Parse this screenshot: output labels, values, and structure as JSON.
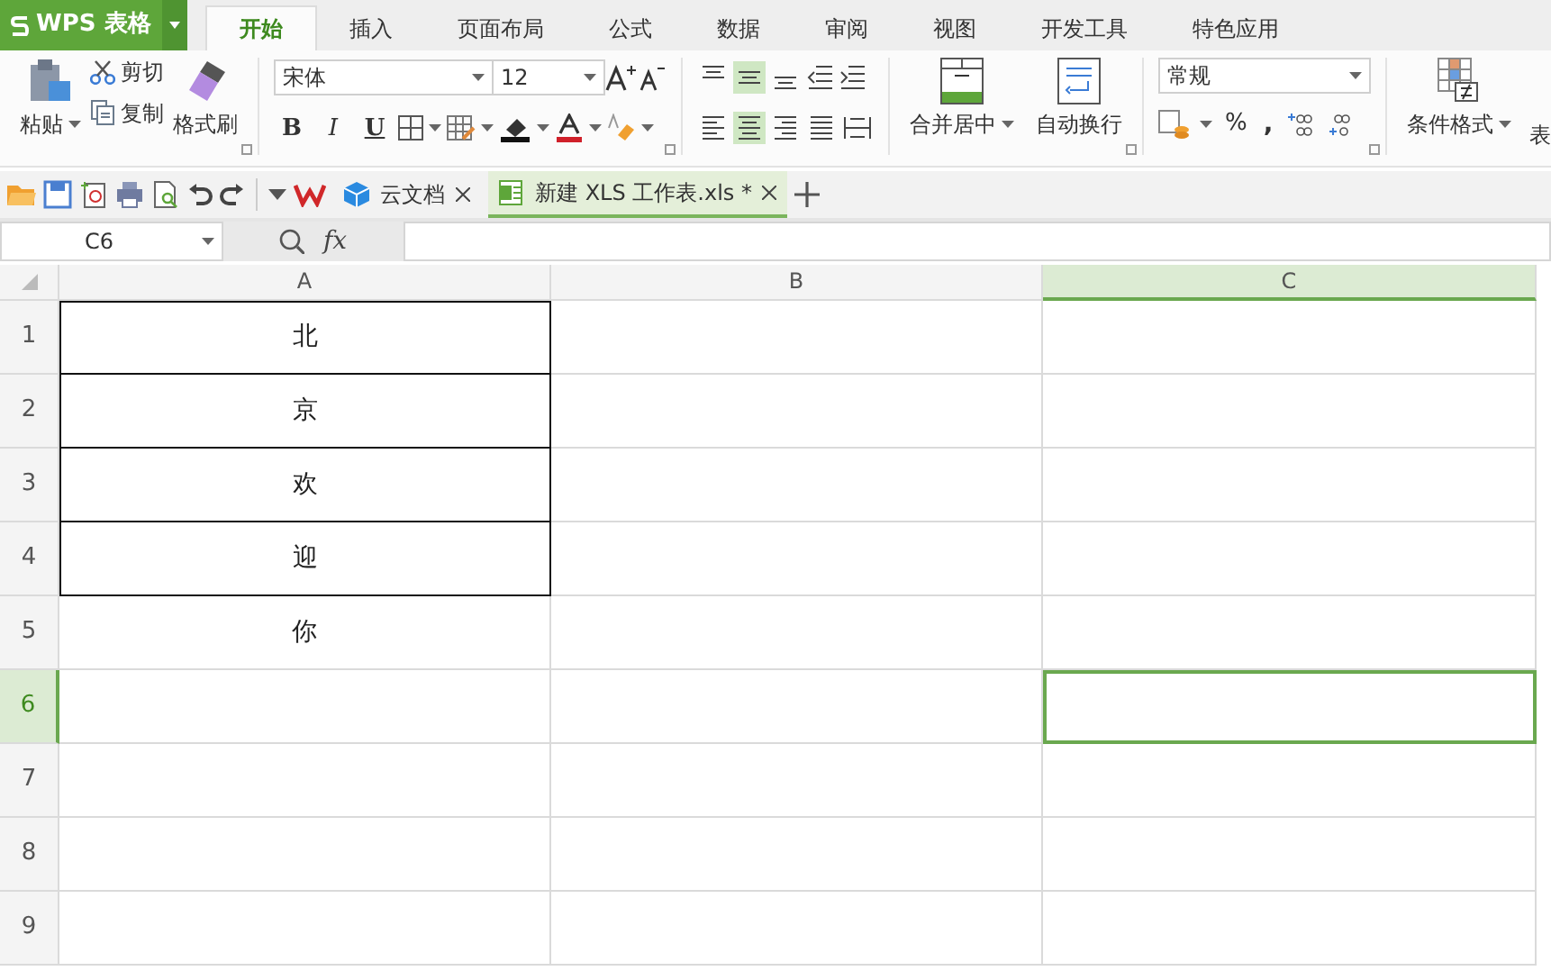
{
  "app": {
    "logo": "WPS 表格"
  },
  "menu_tabs": [
    {
      "label": "开始",
      "selected": true
    },
    {
      "label": "插入",
      "selected": false
    },
    {
      "label": "页面布局",
      "selected": false
    },
    {
      "label": "公式",
      "selected": false
    },
    {
      "label": "数据",
      "selected": false
    },
    {
      "label": "审阅",
      "selected": false
    },
    {
      "label": "视图",
      "selected": false
    },
    {
      "label": "开发工具",
      "selected": false
    },
    {
      "label": "特色应用",
      "selected": false
    }
  ],
  "ribbon": {
    "paste": "粘贴",
    "cut": "剪切",
    "copy": "复制",
    "format_painter": "格式刷",
    "font_name": "宋体",
    "font_size": "12",
    "bold": "B",
    "italic": "I",
    "underline": "U",
    "vertical_align": [
      {
        "kind": "top",
        "selected": false
      },
      {
        "kind": "middle",
        "selected": true
      },
      {
        "kind": "bottom",
        "selected": false
      }
    ],
    "horizontal_align": [
      {
        "kind": "left",
        "selected": false
      },
      {
        "kind": "center",
        "selected": true
      },
      {
        "kind": "right",
        "selected": false
      },
      {
        "kind": "justify",
        "selected": false
      },
      {
        "kind": "distributed",
        "selected": false
      }
    ],
    "merge": "合并居中",
    "wrap": "自动换行",
    "number_format": "常规",
    "percent": "%",
    "comma": ",",
    "conditional": "条件格式",
    "table_style": "表"
  },
  "doc_tabs": [
    {
      "label": "云文档",
      "selected": false
    },
    {
      "label": "新建 XLS 工作表.xls *",
      "selected": true
    }
  ],
  "formula_bar": {
    "name_box": "C6",
    "fx": "fx"
  },
  "columns": [
    {
      "label": "A",
      "selected": false
    },
    {
      "label": "B",
      "selected": false
    },
    {
      "label": "C",
      "selected": true
    }
  ],
  "rows": [
    {
      "label": "1",
      "selected": false,
      "a": {
        "text": "北",
        "bordered": true
      }
    },
    {
      "label": "2",
      "selected": false,
      "a": {
        "text": "京",
        "bordered": true
      }
    },
    {
      "label": "3",
      "selected": false,
      "a": {
        "text": "欢",
        "bordered": true
      }
    },
    {
      "label": "4",
      "selected": false,
      "a": {
        "text": "迎",
        "bordered": true
      }
    },
    {
      "label": "5",
      "selected": false,
      "a": {
        "text": "你",
        "bordered": false
      }
    },
    {
      "label": "6",
      "selected": true
    },
    {
      "label": "7",
      "selected": false
    },
    {
      "label": "8",
      "selected": false
    },
    {
      "label": "9",
      "selected": false
    }
  ]
}
